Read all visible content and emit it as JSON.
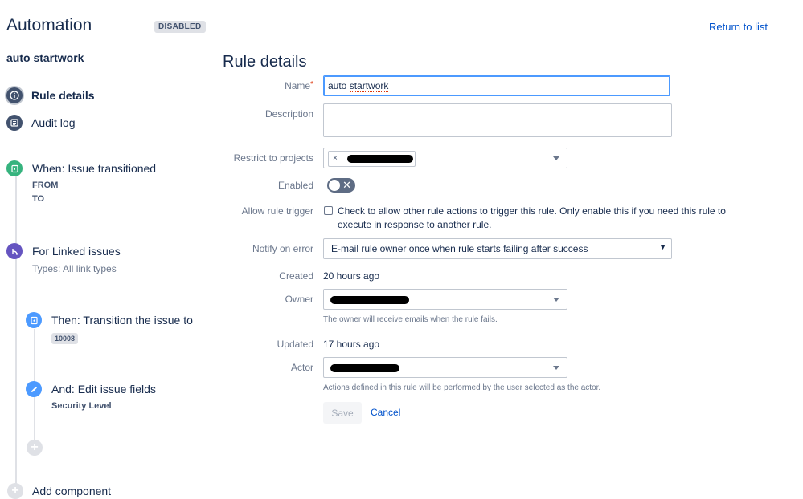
{
  "header": {
    "app_title": "Automation",
    "status_badge": "DISABLED",
    "return_link": "Return to list"
  },
  "sidebar": {
    "rule_name": "auto startwork",
    "nav": [
      {
        "label": "Rule details",
        "icon": "info-icon"
      },
      {
        "label": "Audit log",
        "icon": "list-icon"
      }
    ],
    "components": [
      {
        "title": "When: Issue transitioned",
        "sub1": "FROM",
        "sub2": "TO",
        "icon": "trigger-icon",
        "color": "#36b37e"
      },
      {
        "title": "For Linked issues",
        "types": "Types: All link types",
        "icon": "branch-icon",
        "color": "#6554c0"
      },
      {
        "title": "Then: Transition the issue to",
        "lozenge": "10008",
        "icon": "transition-icon",
        "color": "#4c9aff"
      },
      {
        "title": "And: Edit issue fields",
        "sub": "Security Level",
        "icon": "pencil-icon",
        "color": "#4c9aff"
      }
    ],
    "add_component": "Add component"
  },
  "form": {
    "section_title": "Rule details",
    "labels": {
      "name": "Name",
      "required_mark": "*",
      "description": "Description",
      "restrict": "Restrict to projects",
      "enabled": "Enabled",
      "allow_trigger": "Allow rule trigger",
      "notify": "Notify on error",
      "created": "Created",
      "owner": "Owner",
      "updated": "Updated",
      "actor": "Actor"
    },
    "name_value_prefix": "auto ",
    "name_value_word": "startwork",
    "project_chip_remove": "×",
    "enabled_toggle_symbol": "✕",
    "allow_trigger_text": "Check to allow other rule actions to trigger this rule. Only enable this if you need this rule to execute in response to another rule.",
    "notify_value": "E-mail rule owner once when rule starts failing after success",
    "notify_arrow": "▼",
    "created_value": "20 hours ago",
    "owner_help": "The owner will receive emails when the rule fails.",
    "updated_value": "17 hours ago",
    "actor_help": "Actions defined in this rule will be performed by the user selected as the actor.",
    "save_label": "Save",
    "cancel_label": "Cancel"
  },
  "colors": {
    "accent": "#0052cc",
    "nav_icon": "#42526e",
    "required": "#de350b"
  }
}
